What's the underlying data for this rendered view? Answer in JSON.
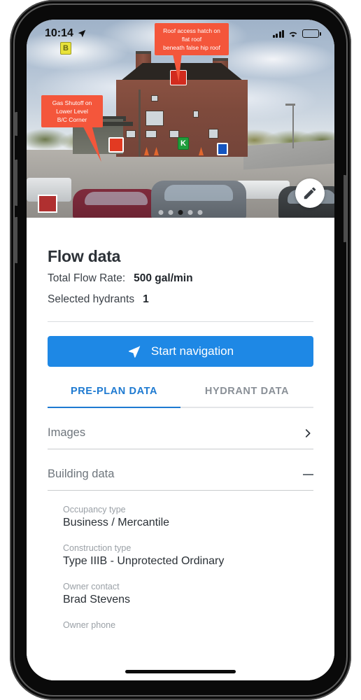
{
  "status_bar": {
    "time": "10:14",
    "location_arrow_icon": "location-arrow-icon",
    "cellular_icon": "cellular-signal-icon",
    "wifi_icon": "wifi-icon",
    "battery_icon": "battery-full-icon"
  },
  "photo": {
    "alt": "Exterior photo of brick building with pre-plan annotations",
    "callouts": [
      {
        "id": "roof-access",
        "line1": "Roof access hatch on flat roof",
        "line2": "beneath false hip roof",
        "color": "#f4563b"
      },
      {
        "id": "gas-shutoff",
        "line1": "Gas Shutoff on Lower Level",
        "line2": "B/C Corner",
        "color": "#f4563b"
      }
    ],
    "markers": [
      {
        "id": "marker-b",
        "label": "B",
        "color": "#e8e23a",
        "name": "building-marker"
      },
      {
        "id": "marker-k",
        "label": "K",
        "color": "#1f9e3c",
        "name": "knox-box-marker"
      },
      {
        "id": "marker-blue",
        "label": "",
        "color": "#1555c0",
        "name": "utility-marker"
      },
      {
        "id": "marker-red-roof",
        "label": "",
        "color": "#d22b1e",
        "name": "roof-hazard-marker"
      },
      {
        "id": "marker-red-gas",
        "label": "",
        "color": "#e23a22",
        "name": "gas-shutoff-marker"
      }
    ],
    "edit_button_icon": "pencil-icon",
    "page_dots": {
      "count": 5,
      "active_index": 2
    }
  },
  "flow": {
    "title": "Flow data",
    "total_flow_label": "Total Flow Rate:",
    "total_flow_value": "500 gal/min",
    "selected_hydrants_label": "Selected hydrants",
    "selected_hydrants_value": "1"
  },
  "nav_button": {
    "label": "Start navigation",
    "icon": "navigation-arrow-icon",
    "color": "#1e88e5"
  },
  "tabs": [
    {
      "label": "PRE-PLAN DATA",
      "active": true
    },
    {
      "label": "HYDRANT DATA",
      "active": false
    }
  ],
  "sections": [
    {
      "id": "images",
      "title": "Images",
      "control": "chevron-right-icon",
      "expanded": false
    },
    {
      "id": "building-data",
      "title": "Building data",
      "control": "minus-icon",
      "expanded": true
    }
  ],
  "building_fields": [
    {
      "label": "Occupancy type",
      "value": "Business / Mercantile"
    },
    {
      "label": "Construction type",
      "value": "Type IIIB - Unprotected Ordinary"
    },
    {
      "label": "Owner contact",
      "value": "Brad Stevens"
    },
    {
      "label": "Owner phone",
      "value": ""
    }
  ],
  "colors": {
    "accent_blue": "#1e88e5",
    "tab_active": "#1e7ad1",
    "callout_red": "#f4563b",
    "text_primary": "#2a3036",
    "text_muted": "#9aa0a6"
  }
}
